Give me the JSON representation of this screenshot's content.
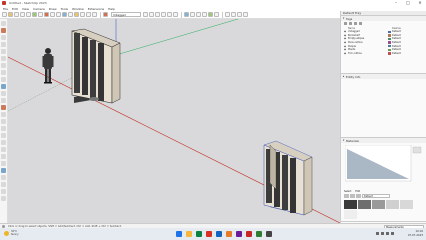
{
  "window": {
    "title": "Untitled - SketchUp 2023",
    "controls": [
      "–",
      "□",
      "✕"
    ]
  },
  "menubar": {
    "items": [
      "File",
      "Edit",
      "View",
      "Camera",
      "Draw",
      "Tools",
      "Window",
      "Extensions",
      "Help"
    ]
  },
  "toolbar": {
    "tag_dropdown": "Untagged"
  },
  "default_tray": {
    "title": "Default Tray",
    "tags_panel": {
      "title": "Tags",
      "columns": [
        "Name",
        "Dashes"
      ],
      "rows": [
        {
          "name": "Untagged",
          "color": "#4a6fa5",
          "dashes": "Default"
        },
        {
          "name": "Bookshelf",
          "color": "#b07a4f",
          "dashes": "Default"
        },
        {
          "name": "Empty-ellipse",
          "color": "#4f8a6b",
          "dashes": "Default"
        },
        {
          "name": "Pens outline",
          "color": "#9b4f8a",
          "dashes": "Default"
        },
        {
          "name": "People",
          "color": "#4f7a9b",
          "dashes": "Default"
        },
        {
          "name": "Plants",
          "color": "#6b9b4f",
          "dashes": "Default"
        },
        {
          "name": "Tick outline",
          "color": "#c05050",
          "dashes": "Default"
        }
      ]
    },
    "entity_info_panel": {
      "title": "Entity Info"
    },
    "materials_panel": {
      "title": "Materials",
      "tabs": [
        "Select",
        "Edit"
      ],
      "category": "Default",
      "thumb_colors": [
        "#3a3a3a",
        "#6e6e6e",
        "#9a9a9a",
        "#cfcfcf",
        "#d8d8d8",
        "#eeeeee"
      ]
    }
  },
  "statusbar": {
    "hint": "Click or drag to select objects. Shift = Add/Subtract. Ctrl = Add. Shift + Ctrl = Subtract.",
    "measurements_label": "Measurements"
  },
  "taskbar": {
    "weather_temp": "32°C",
    "weather_desc": "Sunny",
    "time": "10:16",
    "date": "07-07-2023",
    "app_icon_colors": [
      "#1e73e8",
      "#f6b73c",
      "#0b8043",
      "#d93025",
      "#1565c0",
      "#e67c28",
      "#6a1b9a",
      "#c62828",
      "#2e7d32",
      "#444444"
    ]
  },
  "colors": {
    "viewport_bg": "#d9d9db",
    "axis_red": "#c0392b",
    "axis_green": "#27ae60",
    "axis_blue": "#2f4fbf",
    "model_face": "#e8e0d3",
    "model_dark": "#2d2d2d"
  }
}
